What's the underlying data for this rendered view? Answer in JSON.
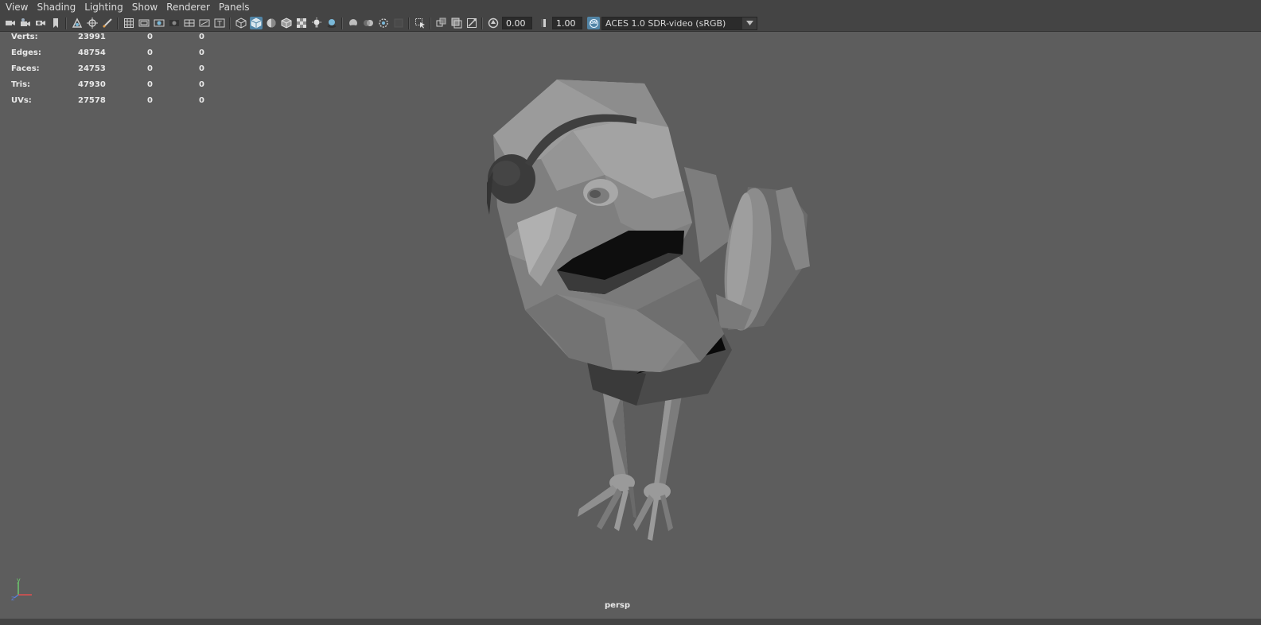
{
  "menu": [
    "View",
    "Shading",
    "Lighting",
    "Show",
    "Renderer",
    "Panels"
  ],
  "toolbar": {
    "exposure": "0.00",
    "gamma": "1.00",
    "color_space": "ACES 1.0 SDR-video (sRGB)",
    "color_mgmt_badge": "ON",
    "accent_color": "#5285a6"
  },
  "hud": {
    "rows": [
      {
        "label": "Verts:",
        "v1": "23991",
        "v2": "0",
        "v3": "0"
      },
      {
        "label": "Edges:",
        "v1": "48754",
        "v2": "0",
        "v3": "0"
      },
      {
        "label": "Faces:",
        "v1": "24753",
        "v2": "0",
        "v3": "0"
      },
      {
        "label": "Tris:",
        "v1": "47930",
        "v2": "0",
        "v3": "0"
      },
      {
        "label": "UVs:",
        "v1": "27578",
        "v2": "0",
        "v3": "0"
      }
    ]
  },
  "viewport": {
    "camera": "persp",
    "axis_labels": {
      "y": "y",
      "z": "z"
    },
    "background": "#5d5d5d"
  }
}
